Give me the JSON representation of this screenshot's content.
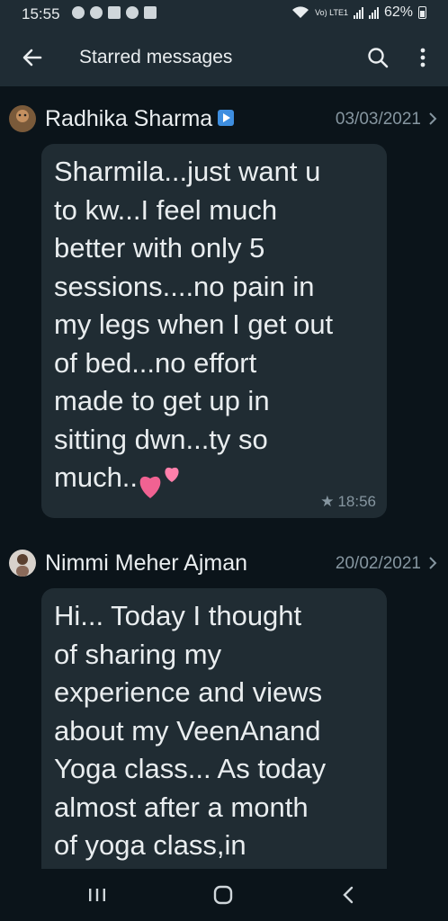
{
  "status_bar": {
    "time": "15:55",
    "network_label": "Vo) LTE1",
    "battery_percent": "62%"
  },
  "app_bar": {
    "title": "Starred messages",
    "back_icon": "arrow-left-icon",
    "search_icon": "search-icon",
    "more_icon": "more-vert-icon"
  },
  "messages": [
    {
      "sender": "Radhika Sharma",
      "date": "03/03/2021",
      "text": "Sharmila...just want u\nto kw...I feel much\nbetter with only 5\nsessions....no pain in\nmy legs when I get out\nof bed...no effort\nmade to get up in\nsitting dwn...ty so\nmuch..",
      "time": "18:56",
      "starred": true
    },
    {
      "sender": "Nimmi Meher Ajman",
      "date": "20/02/2021",
      "text": "Hi... Today I thought\nof sharing my\nexperience and views\nabout my VeenAnand\nYoga class... As today\nalmost after a month\nof yoga class,in"
    }
  ],
  "colors": {
    "background": "#0b141a",
    "bar": "#1f2c34",
    "bubble": "#202c33",
    "secondary_text": "#8696a0",
    "heart": "#f06292"
  }
}
